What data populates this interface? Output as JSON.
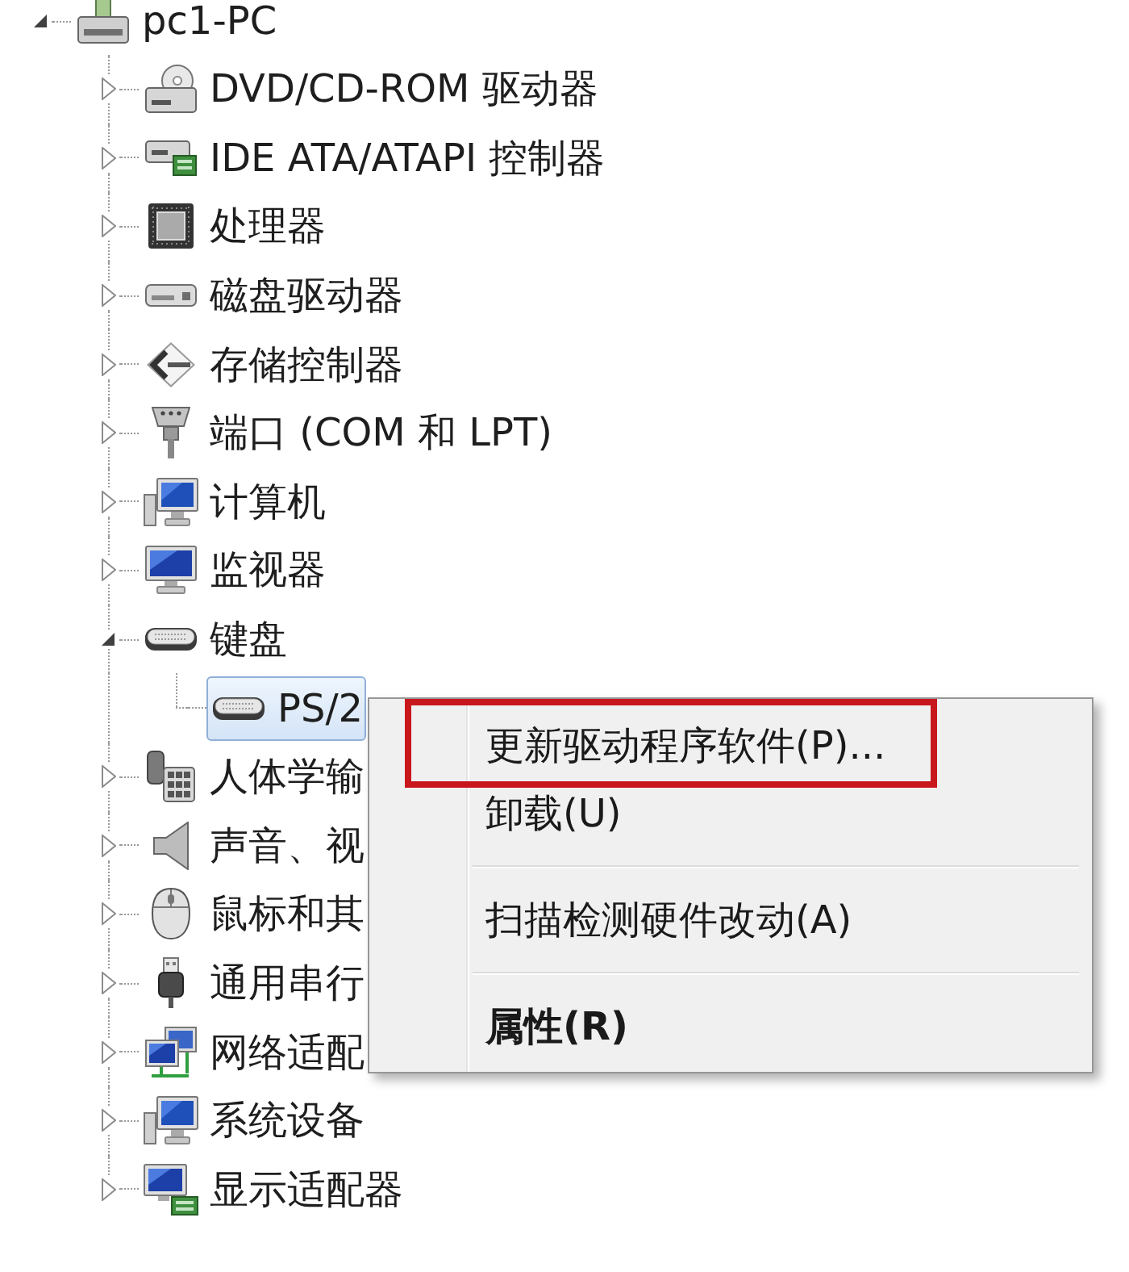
{
  "device_tree": {
    "label": "pc1-PC",
    "kind": "pc",
    "expanded": true,
    "selected": false,
    "children": [
      {
        "label": "DVD/CD-ROM 驱动器",
        "kind": "optical",
        "expanded": false,
        "selected": false
      },
      {
        "label": "IDE ATA/ATAPI 控制器",
        "kind": "ide",
        "expanded": false,
        "selected": false
      },
      {
        "label": "处理器",
        "kind": "cpu",
        "expanded": false,
        "selected": false
      },
      {
        "label": "磁盘驱动器",
        "kind": "disk",
        "expanded": false,
        "selected": false
      },
      {
        "label": "存储控制器",
        "kind": "storage",
        "expanded": false,
        "selected": false
      },
      {
        "label": "端口 (COM 和 LPT)",
        "kind": "port",
        "expanded": false,
        "selected": false
      },
      {
        "label": "计算机",
        "kind": "computer",
        "expanded": false,
        "selected": false
      },
      {
        "label": "监视器",
        "kind": "monitor",
        "expanded": false,
        "selected": false
      },
      {
        "label": "键盘",
        "kind": "keyboard",
        "expanded": true,
        "selected": false,
        "children": [
          {
            "label": "PS/2",
            "kind": "keyboard",
            "selected": true
          }
        ]
      },
      {
        "label": "人体学输",
        "kind": "hid",
        "expanded": false,
        "selected": false
      },
      {
        "label": "声音、视",
        "kind": "sound",
        "expanded": false,
        "selected": false
      },
      {
        "label": "鼠标和其",
        "kind": "mouse",
        "expanded": false,
        "selected": false
      },
      {
        "label": "通用串行",
        "kind": "usb",
        "expanded": false,
        "selected": false
      },
      {
        "label": "网络适配",
        "kind": "network",
        "expanded": false,
        "selected": false
      },
      {
        "label": "系统设备",
        "kind": "system",
        "expanded": false,
        "selected": false
      },
      {
        "label": "显示适配器",
        "kind": "display",
        "expanded": false,
        "selected": false
      }
    ]
  },
  "context_menu": {
    "items": [
      {
        "kind": "item",
        "label": "更新驱动程序软件(P)...",
        "highlighted": true,
        "default": false
      },
      {
        "kind": "item",
        "label": "卸载(U)",
        "highlighted": false,
        "default": false
      },
      {
        "kind": "separator"
      },
      {
        "kind": "item",
        "label": "扫描检测硬件改动(A)",
        "highlighted": false,
        "default": false
      },
      {
        "kind": "separator"
      },
      {
        "kind": "item",
        "label": "属性(R)",
        "highlighted": false,
        "default": true
      }
    ]
  }
}
